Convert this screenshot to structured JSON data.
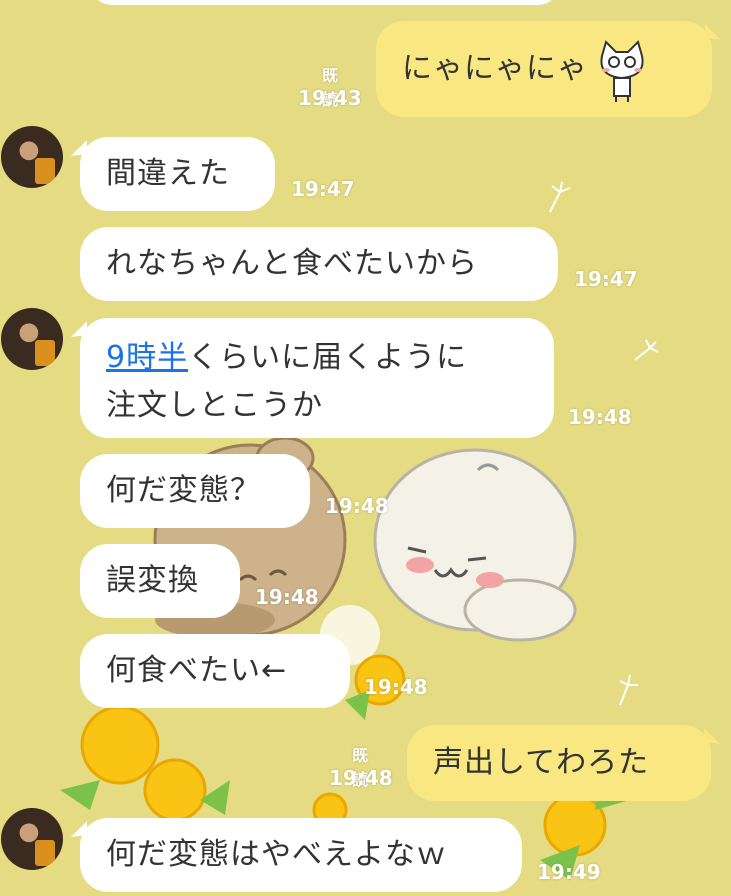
{
  "messages": [
    {
      "side": "out",
      "text": "にゃにゃにゃ",
      "read_label": "既読",
      "time": "19:43"
    },
    {
      "side": "in",
      "text": "間違えた",
      "time": "19:47"
    },
    {
      "side": "in",
      "text": "れなちゃんと食べたいから",
      "time": "19:47"
    },
    {
      "side": "in",
      "link_text": "9時半",
      "text_after_link": "くらいに届くように",
      "line2": "注文しとこうか",
      "time": "19:48"
    },
    {
      "side": "in",
      "text": "何だ変態？",
      "time": "19:48"
    },
    {
      "side": "in",
      "text": "誤変換",
      "time": "19:48"
    },
    {
      "side": "in",
      "text": "何食べたい←",
      "time": "19:48"
    },
    {
      "side": "out",
      "text": "声出してわろた",
      "read_label": "既読",
      "time": "19:48"
    },
    {
      "side": "in",
      "text": "何だ変態はやべえよなｗ",
      "time": "19:49"
    }
  ],
  "colors": {
    "background": "#e5db82",
    "incoming_bubble": "#ffffff",
    "outgoing_bubble": "#f9e782",
    "link": "#1a73e8"
  },
  "icons": {
    "sticker_emoji": "cat-sticker-icon",
    "avatar": "user-avatar"
  }
}
